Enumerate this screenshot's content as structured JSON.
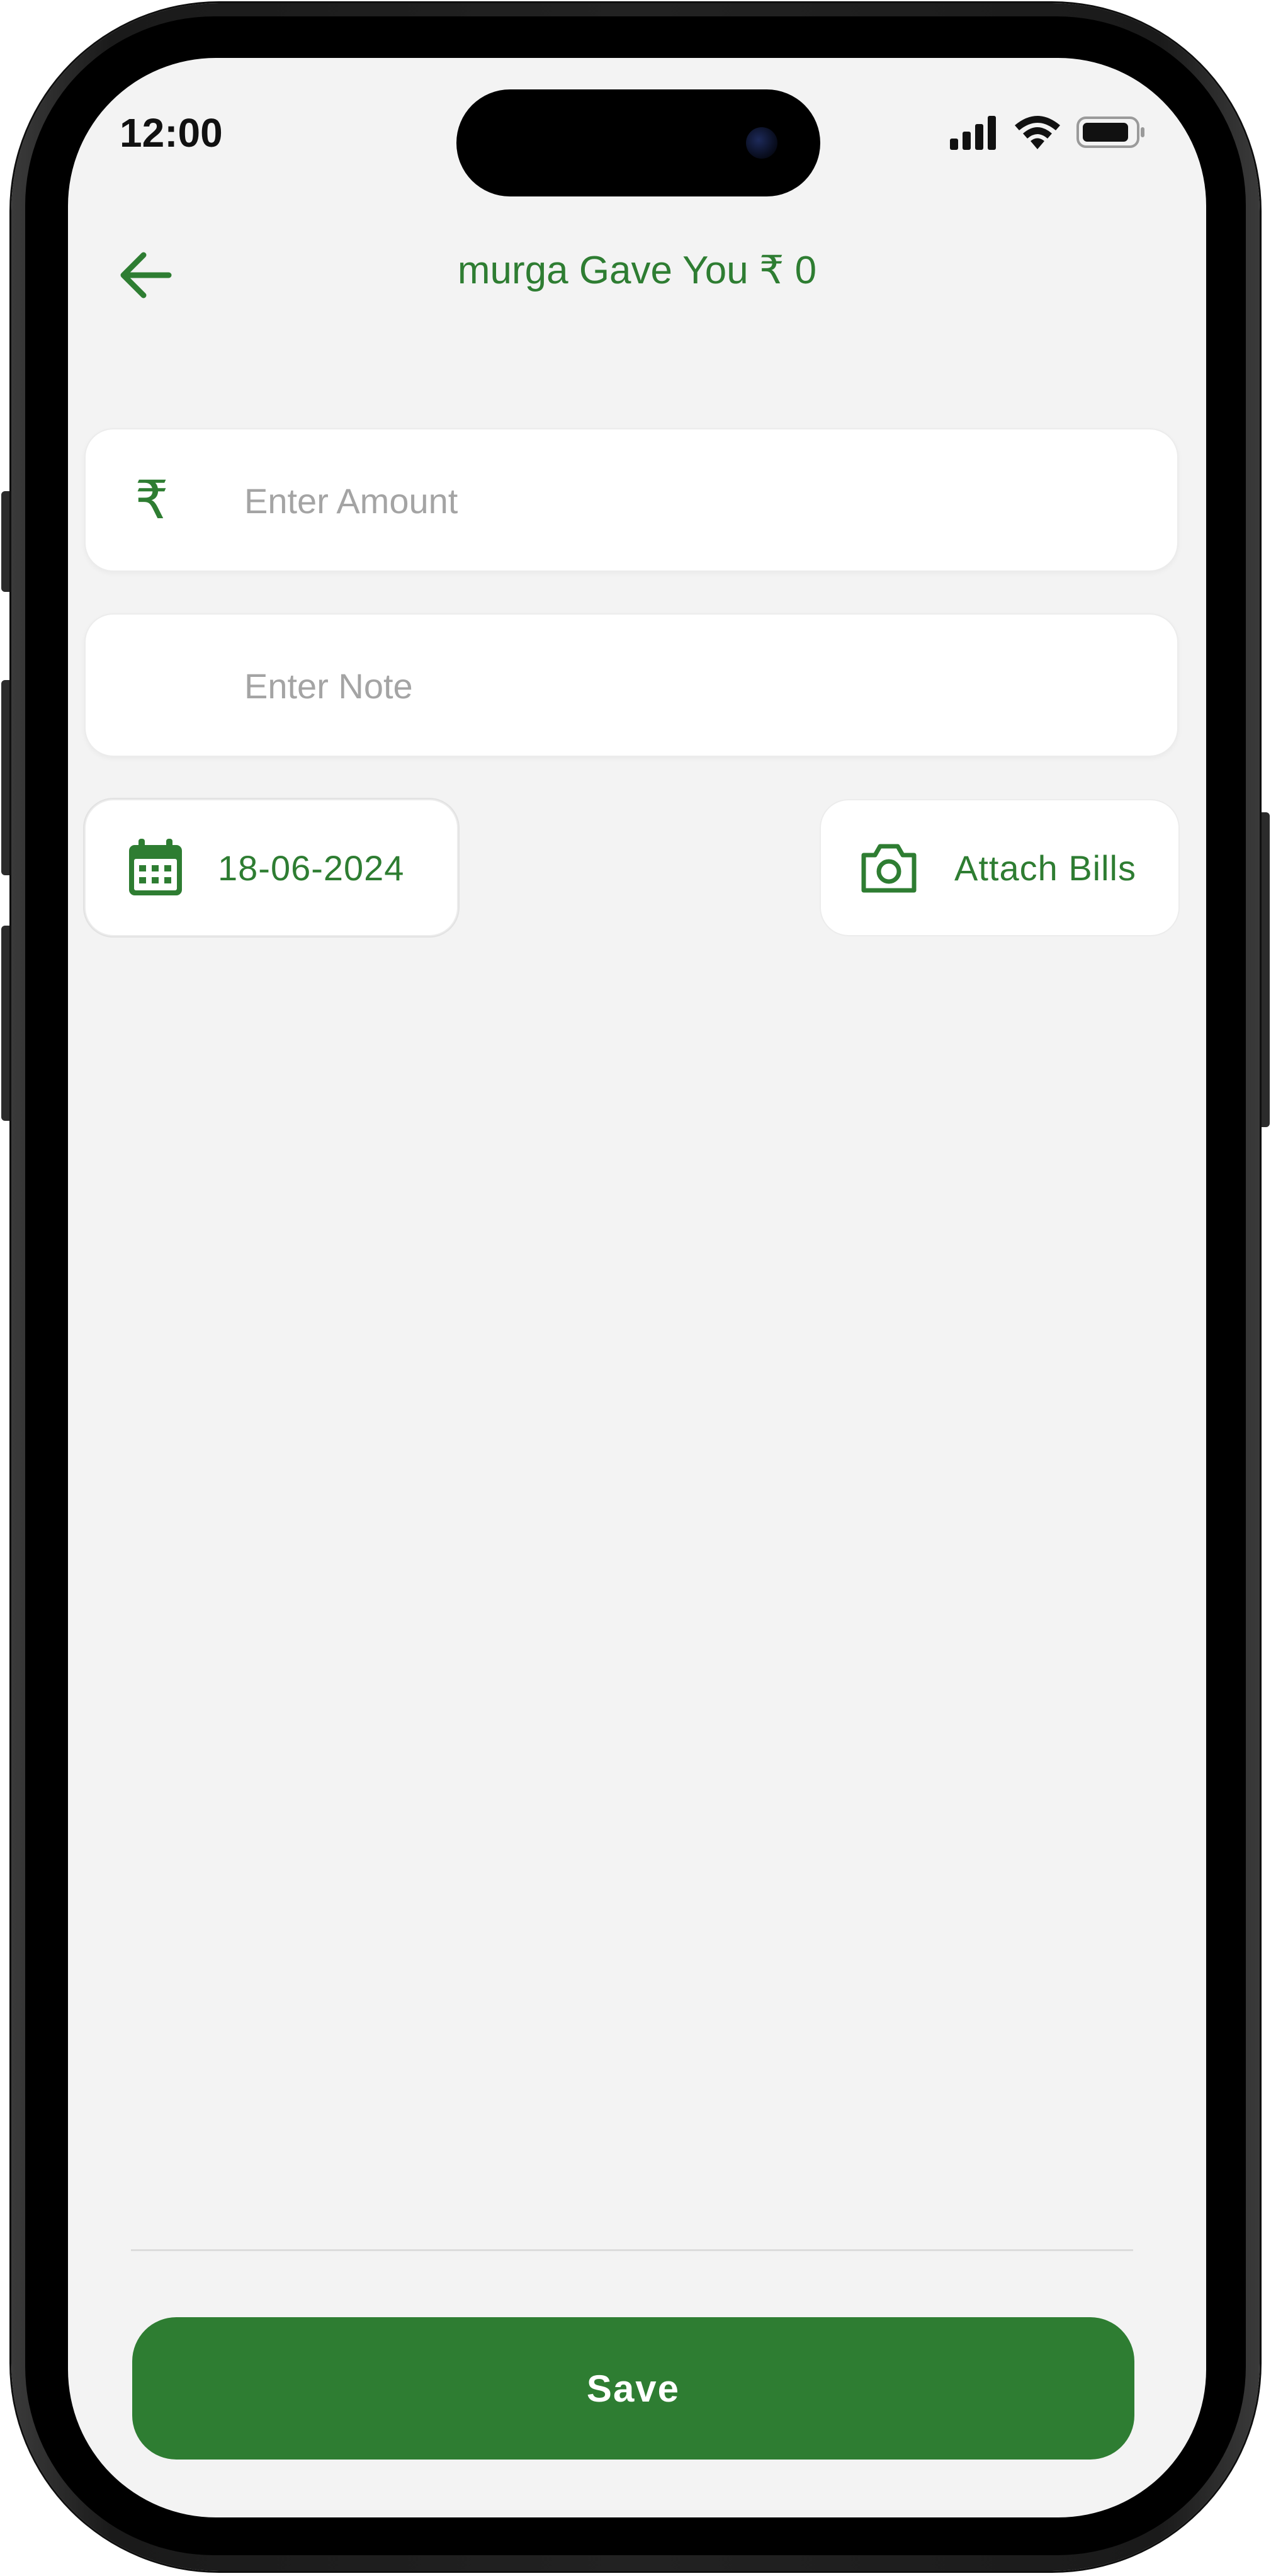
{
  "status_bar": {
    "time": "12:00"
  },
  "header": {
    "title": "murga Gave You ₹ 0",
    "back_icon": "arrow-left-icon"
  },
  "form": {
    "amount": {
      "placeholder": "Enter Amount",
      "value": "",
      "icon": "₹"
    },
    "note": {
      "placeholder": "Enter Note",
      "value": ""
    },
    "date": {
      "value": "18-06-2024",
      "icon": "calendar-icon"
    },
    "attach": {
      "label": "Attach Bills",
      "icon": "camera-icon"
    }
  },
  "footer": {
    "save_label": "Save"
  },
  "colors": {
    "accent": "#2E7D32",
    "background": "#F3F3F3",
    "placeholder": "#A4A4A4"
  }
}
